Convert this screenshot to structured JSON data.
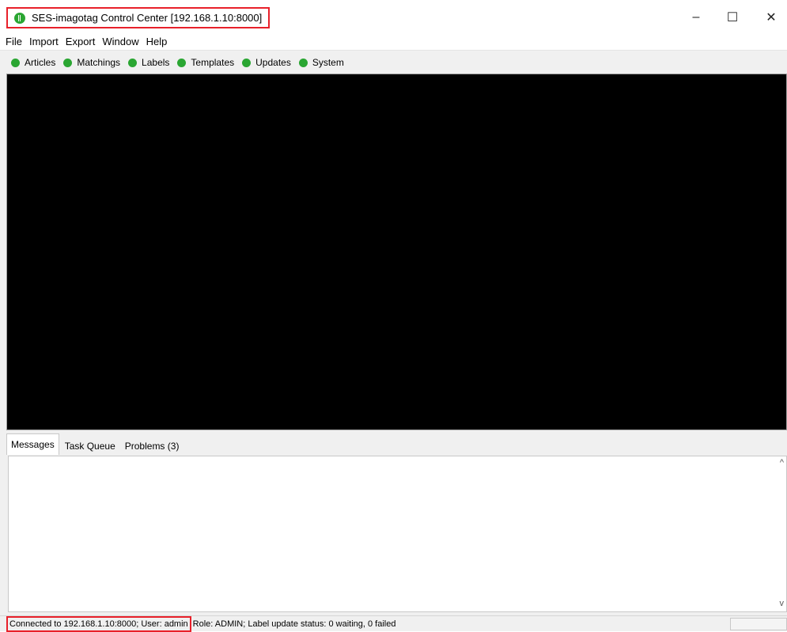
{
  "window": {
    "title": "SES-imagotag Control Center [192.168.1.10:8000]",
    "controls": {
      "minimize": "–",
      "maximize": "☐",
      "close": "✕"
    }
  },
  "menu": [
    "File",
    "Import",
    "Export",
    "Window",
    "Help"
  ],
  "toolbar": {
    "status_color": "#2aa632",
    "items": [
      "Articles",
      "Matchings",
      "Labels",
      "Templates",
      "Updates",
      "System"
    ]
  },
  "panel": {
    "tabs": [
      "Messages",
      "Task Queue",
      "Problems (3)"
    ],
    "scroll_up": "^",
    "scroll_down": "v"
  },
  "status": {
    "connection": "Connected to 192.168.1.10:8000; User: admin",
    "details": "Role: ADMIN; Label update status: 0 waiting, 0 failed"
  },
  "highlight_color": "#e8202a"
}
